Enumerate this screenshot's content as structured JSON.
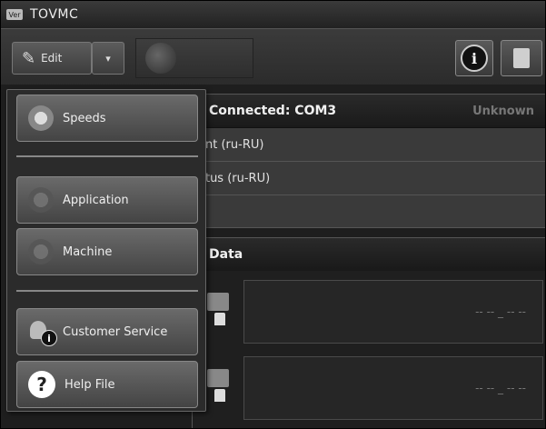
{
  "window": {
    "title": "TOVMC",
    "app_icon_label": "Ver"
  },
  "toolbar": {
    "edit_label": "Edit",
    "edit_dropdown_glyph": "▾",
    "info_glyph": "i"
  },
  "status_panel": {
    "connection": "Connected: COM3",
    "state": "Unknown",
    "rows": [
      "ent (ru-RU)",
      "atus (ru-RU)"
    ]
  },
  "data_panel": {
    "title": "Data",
    "readings": [
      "-- --  _ -- --",
      "-- --  _ -- --"
    ]
  },
  "menu": {
    "items": [
      {
        "label": "Speeds",
        "icon": "speeds-icon"
      },
      {
        "label": "Application",
        "icon": "application-icon"
      },
      {
        "label": "Machine",
        "icon": "machine-icon"
      },
      {
        "label": "Customer Service",
        "icon": "customer-service-icon"
      },
      {
        "label": "Help File",
        "icon": "help-icon"
      }
    ],
    "help_glyph": "?"
  },
  "colors": {
    "background": "#1e1e1e",
    "panel": "#3a3a3a",
    "text": "#e0e0e0"
  }
}
